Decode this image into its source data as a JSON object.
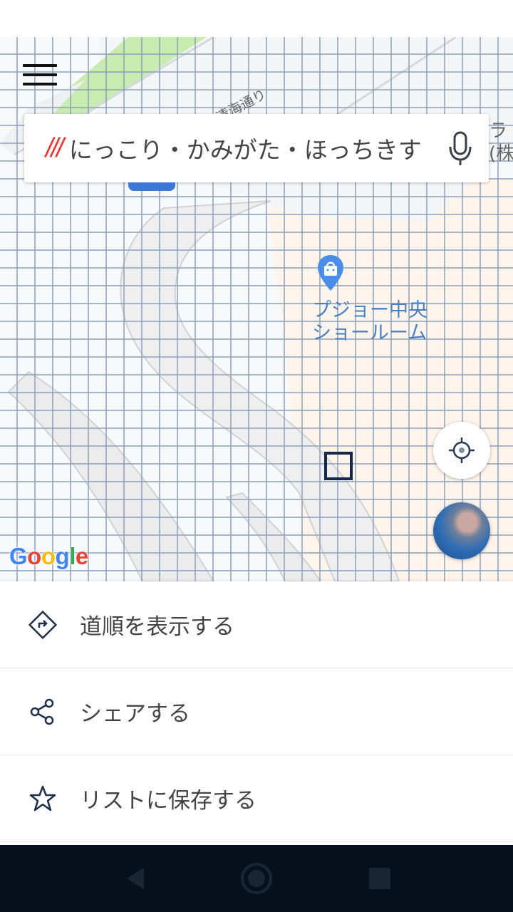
{
  "search": {
    "prefix": "///",
    "address": "にっこり・かみがた・ほっちきす"
  },
  "map": {
    "road_label": "清海通り",
    "edge_label_line1": "ラ",
    "edge_label_line2": "(株",
    "place_name_line1": "プジョー中央",
    "place_name_line2": "ショールーム",
    "google_letters": [
      "G",
      "o",
      "o",
      "g",
      "l",
      "e"
    ],
    "google_colors": [
      "#4285F4",
      "#EA4335",
      "#FBBC05",
      "#4285F4",
      "#34A853",
      "#EA4335"
    ]
  },
  "actions": [
    {
      "label": "道順を表示する",
      "icon": "directions-icon"
    },
    {
      "label": "シェアする",
      "icon": "share-icon"
    },
    {
      "label": "リストに保存する",
      "icon": "star-icon"
    }
  ],
  "icons": {
    "menu": "hamburger-menu-icon",
    "mic": "microphone-icon",
    "locate": "crosshair-icon",
    "layers": "satellite-layer-icon",
    "nav_back": "back-triangle-icon",
    "nav_home": "home-circle-icon",
    "nav_recents": "recents-square-icon"
  },
  "colors": {
    "accent_red": "#e53935",
    "place_blue": "#4a7fc1",
    "nav_bar": "#07111e"
  }
}
